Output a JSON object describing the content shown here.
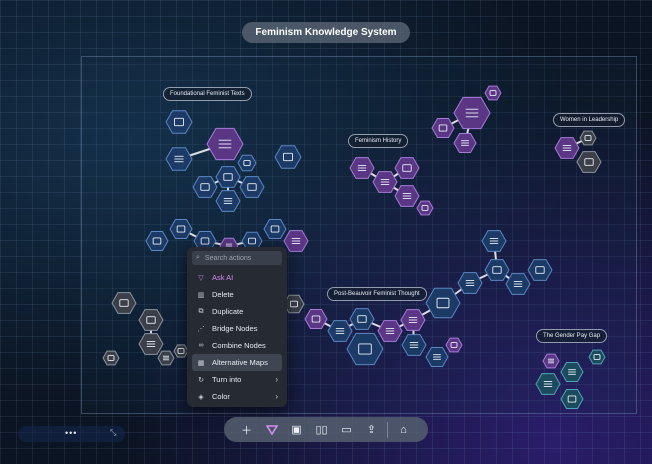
{
  "title": "Feminism Knowledge System",
  "cluster_labels": [
    "Foundational Feminist Texts",
    "Feminism History",
    "Women in Leadership",
    "Post-Beauvoir Feminist Thought",
    "The Gender Pay Gap"
  ],
  "context_menu": {
    "search_placeholder": "Search actions",
    "items": [
      {
        "label": "Ask AI",
        "icon": "ai-icon",
        "ai": true
      },
      {
        "label": "Delete",
        "icon": "trash-icon"
      },
      {
        "label": "Duplicate",
        "icon": "duplicate-icon"
      },
      {
        "label": "Bridge Nodes",
        "icon": "bridge-icon"
      },
      {
        "label": "Combine Nodes",
        "icon": "combine-icon"
      },
      {
        "label": "Alternative Maps",
        "icon": "map-icon",
        "active": true
      },
      {
        "label": "Turn into",
        "icon": "convert-icon",
        "submenu": true
      },
      {
        "label": "Color",
        "icon": "paint-bucket-icon",
        "submenu": true
      }
    ]
  },
  "toolbar": [
    "add-icon",
    "logo-icon",
    "media-icon",
    "book-icon",
    "present-icon",
    "share-icon",
    "home-icon"
  ],
  "colors": {
    "accent_purple": "#b46be0",
    "node_blue": "#1c3a66",
    "node_purple": "#5a3685",
    "node_gray": "#3a3f48",
    "node_teal": "#1b4b5c"
  }
}
